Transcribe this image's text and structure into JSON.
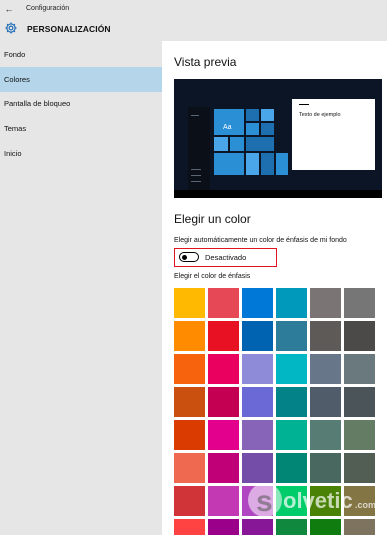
{
  "window": {
    "title": "Configuración",
    "back_icon": "back-arrow-icon"
  },
  "header": {
    "title": "PERSONALIZACIÓN",
    "icon": "gear-icon"
  },
  "sidebar": {
    "items": [
      {
        "label": "Fondo",
        "active": false
      },
      {
        "label": "Colores",
        "active": true
      },
      {
        "label": "Pantalla de bloqueo",
        "active": false
      },
      {
        "label": "Temas",
        "active": false
      },
      {
        "label": "Inicio",
        "active": false
      }
    ]
  },
  "main": {
    "preview_heading": "Vista previa",
    "preview": {
      "window_text": "Texto de ejemplo",
      "tile_label": "Aa"
    },
    "color_heading": "Elegir un color",
    "auto_color_label": "Elegir automáticamente un color de énfasis de mi fondo",
    "auto_color_state": "Desactivado",
    "accent_label": "Elegir el color de énfasis",
    "swatches": [
      [
        "#ffb900",
        "#e74856",
        "#0078d7",
        "#0099bc",
        "#7a7574",
        "#767676"
      ],
      [
        "#ff8c00",
        "#e81123",
        "#0063b1",
        "#2d7d9a",
        "#5d5a58",
        "#4c4a48"
      ],
      [
        "#f7630c",
        "#ea005e",
        "#8e8cd8",
        "#00b7c3",
        "#68768a",
        "#69797e"
      ],
      [
        "#ca5010",
        "#c30052",
        "#6b69d6",
        "#038387",
        "#515c6b",
        "#4a5459"
      ],
      [
        "#da3b01",
        "#e3008c",
        "#8764b8",
        "#00b294",
        "#567c73",
        "#647c64"
      ],
      [
        "#ef6950",
        "#bf0077",
        "#744da9",
        "#018574",
        "#486860",
        "#525e54"
      ],
      [
        "#d13438",
        "#c239b3",
        "#b146c2",
        "#00cc6a",
        "#498205",
        "#847545"
      ],
      [
        "#ff4343",
        "#9a0089",
        "#881798",
        "#10893e",
        "#107c10",
        "#7e735f"
      ]
    ]
  },
  "watermark": {
    "text": "solvetic.com"
  }
}
